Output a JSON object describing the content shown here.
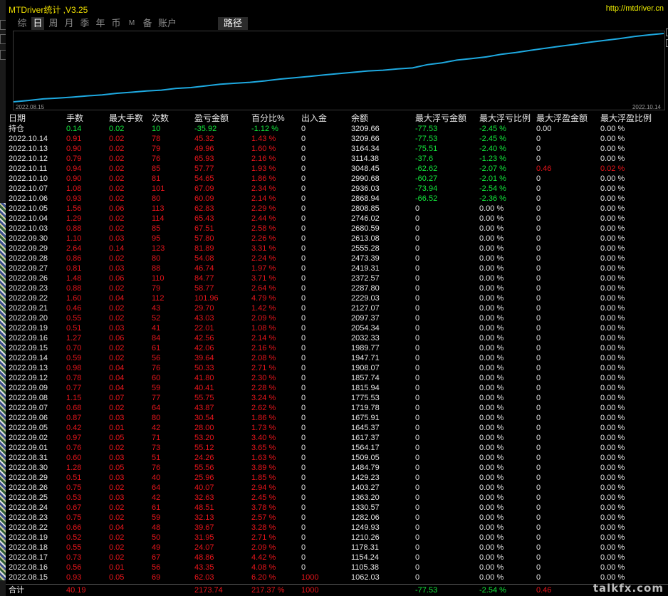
{
  "window": {
    "title": "MTDriver统计 ,V3.25",
    "url": "http://mtdriver.cn"
  },
  "tabs": [
    {
      "label": "综",
      "active": false
    },
    {
      "label": "日",
      "active": true
    },
    {
      "label": "周",
      "active": false
    },
    {
      "label": "月",
      "active": false
    },
    {
      "label": "季",
      "active": false
    },
    {
      "label": "年",
      "active": false
    },
    {
      "label": "币",
      "active": false
    },
    {
      "label": "M",
      "active": false
    },
    {
      "label": "备",
      "active": false
    },
    {
      "label": "账户",
      "active": false
    },
    {
      "label": "路径",
      "active": false
    }
  ],
  "chart_data": {
    "type": "line",
    "x_start_label": "2022.08.15",
    "x_end_label": "2022.10.14",
    "x": [
      "2022.08.15",
      "2022.08.16",
      "2022.08.17",
      "2022.08.18",
      "2022.08.19",
      "2022.08.22",
      "2022.08.23",
      "2022.08.24",
      "2022.08.25",
      "2022.08.26",
      "2022.08.29",
      "2022.08.30",
      "2022.08.31",
      "2022.09.01",
      "2022.09.02",
      "2022.09.05",
      "2022.09.06",
      "2022.09.07",
      "2022.09.08",
      "2022.09.09",
      "2022.09.12",
      "2022.09.13",
      "2022.09.14",
      "2022.09.15",
      "2022.09.16",
      "2022.09.19",
      "2022.09.20",
      "2022.09.21",
      "2022.09.22",
      "2022.09.23",
      "2022.09.26",
      "2022.09.27",
      "2022.09.28",
      "2022.09.29",
      "2022.09.30",
      "2022.10.03",
      "2022.10.04",
      "2022.10.05",
      "2022.10.06",
      "2022.10.07",
      "2022.10.10",
      "2022.10.11",
      "2022.10.12",
      "2022.10.13",
      "2022.10.14"
    ],
    "y": [
      1062.03,
      1105.38,
      1154.24,
      1178.31,
      1210.26,
      1249.93,
      1282.06,
      1330.57,
      1363.2,
      1403.27,
      1429.23,
      1484.79,
      1509.05,
      1564.17,
      1617.37,
      1645.37,
      1675.91,
      1719.78,
      1775.53,
      1815.94,
      1857.74,
      1908.07,
      1947.71,
      1989.77,
      2032.33,
      2054.34,
      2097.37,
      2127.07,
      2229.03,
      2287.8,
      2372.57,
      2419.31,
      2473.39,
      2555.28,
      2613.08,
      2680.59,
      2746.02,
      2808.85,
      2868.94,
      2936.03,
      2990.68,
      3048.45,
      3114.38,
      3164.34,
      3209.66
    ],
    "color": "#1ea9e0",
    "grid": false
  },
  "table": {
    "headers": [
      "日期",
      "手数",
      "最大手数",
      "次数",
      "盈亏金额",
      "百分比%",
      "出入金",
      "余额",
      "最大浮亏金额",
      "最大浮亏比例",
      "最大浮盈金额",
      "最大浮盈比例"
    ],
    "position": {
      "date": "持仓",
      "lots": "0.14",
      "max_lots": "0.02",
      "count": "10",
      "pnl": "-35.92",
      "pct": "-1.12 %",
      "flow": "0",
      "balance": "3209.66",
      "max_float_loss": "-77.53",
      "max_float_loss_pct": "-2.45 %",
      "max_float_profit": "0.00",
      "max_float_profit_pct": "0.00 %"
    },
    "rows": [
      [
        "2022.10.14",
        "0.91",
        "0.02",
        "78",
        "45.32",
        "1.43 %",
        "0",
        "3209.66",
        "-77.53",
        "-2.45 %",
        "0",
        "0.00 %"
      ],
      [
        "2022.10.13",
        "0.90",
        "0.02",
        "79",
        "49.96",
        "1.60 %",
        "0",
        "3164.34",
        "-75.51",
        "-2.40 %",
        "0",
        "0.00 %"
      ],
      [
        "2022.10.12",
        "0.79",
        "0.02",
        "76",
        "65.93",
        "2.16 %",
        "0",
        "3114.38",
        "-37.6",
        "-1.23 %",
        "0",
        "0.00 %"
      ],
      [
        "2022.10.11",
        "0.94",
        "0.02",
        "85",
        "57.77",
        "1.93 %",
        "0",
        "3048.45",
        "-62.62",
        "-2.07 %",
        "0.46",
        "0.02 %"
      ],
      [
        "2022.10.10",
        "0.90",
        "0.02",
        "81",
        "54.65",
        "1.86 %",
        "0",
        "2990.68",
        "-60.27",
        "-2.01 %",
        "0",
        "0.00 %"
      ],
      [
        "2022.10.07",
        "1.08",
        "0.02",
        "101",
        "67.09",
        "2.34 %",
        "0",
        "2936.03",
        "-73.94",
        "-2.54 %",
        "0",
        "0.00 %"
      ],
      [
        "2022.10.06",
        "0.93",
        "0.02",
        "80",
        "60.09",
        "2.14 %",
        "0",
        "2868.94",
        "-66.52",
        "-2.36 %",
        "0",
        "0.00 %"
      ],
      [
        "2022.10.05",
        "1.56",
        "0.06",
        "113",
        "62.83",
        "2.29 %",
        "0",
        "2808.85",
        "0",
        "0.00 %",
        "0",
        "0.00 %"
      ],
      [
        "2022.10.04",
        "1.29",
        "0.02",
        "114",
        "65.43",
        "2.44 %",
        "0",
        "2746.02",
        "0",
        "0.00 %",
        "0",
        "0.00 %"
      ],
      [
        "2022.10.03",
        "0.88",
        "0.02",
        "85",
        "67.51",
        "2.58 %",
        "0",
        "2680.59",
        "0",
        "0.00 %",
        "0",
        "0.00 %"
      ],
      [
        "2022.09.30",
        "1.10",
        "0.03",
        "95",
        "57.80",
        "2.26 %",
        "0",
        "2613.08",
        "0",
        "0.00 %",
        "0",
        "0.00 %"
      ],
      [
        "2022.09.29",
        "2.64",
        "0.14",
        "123",
        "81.89",
        "3.31 %",
        "0",
        "2555.28",
        "0",
        "0.00 %",
        "0",
        "0.00 %"
      ],
      [
        "2022.09.28",
        "0.86",
        "0.02",
        "80",
        "54.08",
        "2.24 %",
        "0",
        "2473.39",
        "0",
        "0.00 %",
        "0",
        "0.00 %"
      ],
      [
        "2022.09.27",
        "0.81",
        "0.03",
        "88",
        "46.74",
        "1.97 %",
        "0",
        "2419.31",
        "0",
        "0.00 %",
        "0",
        "0.00 %"
      ],
      [
        "2022.09.26",
        "1.48",
        "0.06",
        "110",
        "84.77",
        "3.71 %",
        "0",
        "2372.57",
        "0",
        "0.00 %",
        "0",
        "0.00 %"
      ],
      [
        "2022.09.23",
        "0.88",
        "0.02",
        "79",
        "58.77",
        "2.64 %",
        "0",
        "2287.80",
        "0",
        "0.00 %",
        "0",
        "0.00 %"
      ],
      [
        "2022.09.22",
        "1.60",
        "0.04",
        "112",
        "101.96",
        "4.79 %",
        "0",
        "2229.03",
        "0",
        "0.00 %",
        "0",
        "0.00 %"
      ],
      [
        "2022.09.21",
        "0.46",
        "0.02",
        "43",
        "29.70",
        "1.42 %",
        "0",
        "2127.07",
        "0",
        "0.00 %",
        "0",
        "0.00 %"
      ],
      [
        "2022.09.20",
        "0.55",
        "0.02",
        "52",
        "43.03",
        "2.09 %",
        "0",
        "2097.37",
        "0",
        "0.00 %",
        "0",
        "0.00 %"
      ],
      [
        "2022.09.19",
        "0.51",
        "0.03",
        "41",
        "22.01",
        "1.08 %",
        "0",
        "2054.34",
        "0",
        "0.00 %",
        "0",
        "0.00 %"
      ],
      [
        "2022.09.16",
        "1.27",
        "0.06",
        "84",
        "42.56",
        "2.14 %",
        "0",
        "2032.33",
        "0",
        "0.00 %",
        "0",
        "0.00 %"
      ],
      [
        "2022.09.15",
        "0.70",
        "0.02",
        "61",
        "42.06",
        "2.16 %",
        "0",
        "1989.77",
        "0",
        "0.00 %",
        "0",
        "0.00 %"
      ],
      [
        "2022.09.14",
        "0.59",
        "0.02",
        "56",
        "39.64",
        "2.08 %",
        "0",
        "1947.71",
        "0",
        "0.00 %",
        "0",
        "0.00 %"
      ],
      [
        "2022.09.13",
        "0.98",
        "0.04",
        "76",
        "50.33",
        "2.71 %",
        "0",
        "1908.07",
        "0",
        "0.00 %",
        "0",
        "0.00 %"
      ],
      [
        "2022.09.12",
        "0.78",
        "0.04",
        "60",
        "41.80",
        "2.30 %",
        "0",
        "1857.74",
        "0",
        "0.00 %",
        "0",
        "0.00 %"
      ],
      [
        "2022.09.09",
        "0.77",
        "0.04",
        "59",
        "40.41",
        "2.28 %",
        "0",
        "1815.94",
        "0",
        "0.00 %",
        "0",
        "0.00 %"
      ],
      [
        "2022.09.08",
        "1.15",
        "0.07",
        "77",
        "55.75",
        "3.24 %",
        "0",
        "1775.53",
        "0",
        "0.00 %",
        "0",
        "0.00 %"
      ],
      [
        "2022.09.07",
        "0.68",
        "0.02",
        "64",
        "43.87",
        "2.62 %",
        "0",
        "1719.78",
        "0",
        "0.00 %",
        "0",
        "0.00 %"
      ],
      [
        "2022.09.06",
        "0.87",
        "0.03",
        "80",
        "30.54",
        "1.86 %",
        "0",
        "1675.91",
        "0",
        "0.00 %",
        "0",
        "0.00 %"
      ],
      [
        "2022.09.05",
        "0.42",
        "0.01",
        "42",
        "28.00",
        "1.73 %",
        "0",
        "1645.37",
        "0",
        "0.00 %",
        "0",
        "0.00 %"
      ],
      [
        "2022.09.02",
        "0.97",
        "0.05",
        "71",
        "53.20",
        "3.40 %",
        "0",
        "1617.37",
        "0",
        "0.00 %",
        "0",
        "0.00 %"
      ],
      [
        "2022.09.01",
        "0.76",
        "0.02",
        "73",
        "55.12",
        "3.65 %",
        "0",
        "1564.17",
        "0",
        "0.00 %",
        "0",
        "0.00 %"
      ],
      [
        "2022.08.31",
        "0.60",
        "0.03",
        "51",
        "24.26",
        "1.63 %",
        "0",
        "1509.05",
        "0",
        "0.00 %",
        "0",
        "0.00 %"
      ],
      [
        "2022.08.30",
        "1.28",
        "0.05",
        "76",
        "55.56",
        "3.89 %",
        "0",
        "1484.79",
        "0",
        "0.00 %",
        "0",
        "0.00 %"
      ],
      [
        "2022.08.29",
        "0.51",
        "0.03",
        "40",
        "25.96",
        "1.85 %",
        "0",
        "1429.23",
        "0",
        "0.00 %",
        "0",
        "0.00 %"
      ],
      [
        "2022.08.26",
        "0.75",
        "0.02",
        "64",
        "40.07",
        "2.94 %",
        "0",
        "1403.27",
        "0",
        "0.00 %",
        "0",
        "0.00 %"
      ],
      [
        "2022.08.25",
        "0.53",
        "0.03",
        "42",
        "32.63",
        "2.45 %",
        "0",
        "1363.20",
        "0",
        "0.00 %",
        "0",
        "0.00 %"
      ],
      [
        "2022.08.24",
        "0.67",
        "0.02",
        "61",
        "48.51",
        "3.78 %",
        "0",
        "1330.57",
        "0",
        "0.00 %",
        "0",
        "0.00 %"
      ],
      [
        "2022.08.23",
        "0.75",
        "0.02",
        "59",
        "32.13",
        "2.57 %",
        "0",
        "1282.06",
        "0",
        "0.00 %",
        "0",
        "0.00 %"
      ],
      [
        "2022.08.22",
        "0.66",
        "0.04",
        "48",
        "39.67",
        "3.28 %",
        "0",
        "1249.93",
        "0",
        "0.00 %",
        "0",
        "0.00 %"
      ],
      [
        "2022.08.19",
        "0.52",
        "0.02",
        "50",
        "31.95",
        "2.71 %",
        "0",
        "1210.26",
        "0",
        "0.00 %",
        "0",
        "0.00 %"
      ],
      [
        "2022.08.18",
        "0.55",
        "0.02",
        "49",
        "24.07",
        "2.09 %",
        "0",
        "1178.31",
        "0",
        "0.00 %",
        "0",
        "0.00 %"
      ],
      [
        "2022.08.17",
        "0.73",
        "0.02",
        "67",
        "48.86",
        "4.42 %",
        "0",
        "1154.24",
        "0",
        "0.00 %",
        "0",
        "0.00 %"
      ],
      [
        "2022.08.16",
        "0.56",
        "0.01",
        "56",
        "43.35",
        "4.08 %",
        "0",
        "1105.38",
        "0",
        "0.00 %",
        "0",
        "0.00 %"
      ],
      [
        "2022.08.15",
        "0.93",
        "0.05",
        "69",
        "62.03",
        "6.20 %",
        "1000",
        "1062.03",
        "0",
        "0.00 %",
        "0",
        "0.00 %"
      ]
    ],
    "total": {
      "label": "合计",
      "lots": "40.19",
      "pnl": "2173.74",
      "pct": "217.37 %",
      "flow": "1000",
      "max_float_loss": "-77.53",
      "max_float_loss_pct": "-2.54 %",
      "max_float_profit": "0.46"
    }
  },
  "watermark": "talkfx.com",
  "colors": {
    "profit": "#e8151b",
    "loss": "#13e83c",
    "line": "#1ea9e0",
    "title": "#f0e000"
  }
}
